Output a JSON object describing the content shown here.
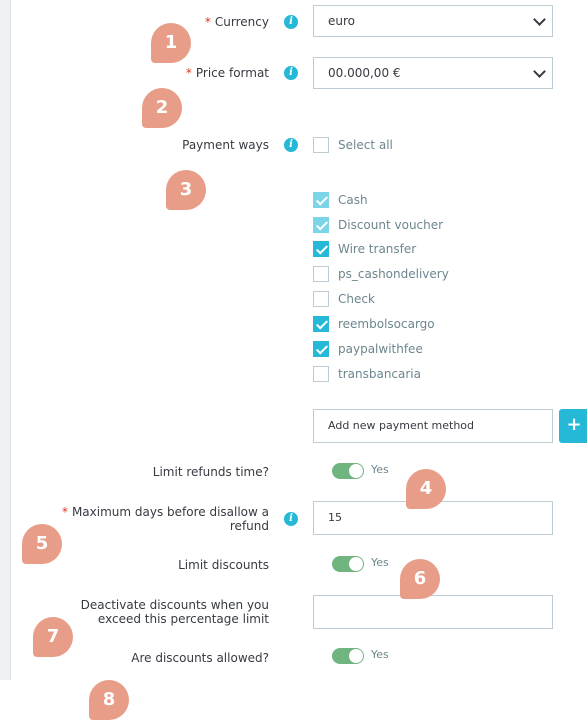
{
  "form": {
    "currency": {
      "label": "Currency",
      "value": "euro"
    },
    "price_format": {
      "label": "Price format",
      "value": "00.000,00 €"
    },
    "payment_ways": {
      "label": "Payment ways",
      "select_all": "Select all",
      "methods": [
        {
          "label": "Cash",
          "state": "checked-disabled"
        },
        {
          "label": "Discount voucher",
          "state": "checked-disabled"
        },
        {
          "label": "Wire transfer",
          "state": "checked"
        },
        {
          "label": "ps_cashondelivery",
          "state": "unchecked"
        },
        {
          "label": "Check",
          "state": "unchecked"
        },
        {
          "label": "reembolsocargo",
          "state": "checked"
        },
        {
          "label": "paypalwithfee",
          "state": "checked"
        },
        {
          "label": "transbancaria",
          "state": "unchecked"
        }
      ],
      "add_new_placeholder": "Add new payment method",
      "add_button": "+"
    },
    "limit_refunds": {
      "label": "Limit refunds time?",
      "toggle": "Yes"
    },
    "max_days": {
      "label_line1": "Maximum days before disallow a",
      "label_line2": "refund",
      "value": "15"
    },
    "limit_discounts": {
      "label": "Limit discounts",
      "toggle": "Yes"
    },
    "deactivate_discounts": {
      "label_line1": "Deactivate discounts when you",
      "label_line2": "exceed this percentage limit",
      "value": ""
    },
    "discounts_allowed": {
      "label": "Are discounts allowed?",
      "toggle": "Yes"
    }
  },
  "badges": [
    "1",
    "2",
    "3",
    "4",
    "5",
    "6",
    "7",
    "8"
  ],
  "colors": {
    "accent": "#25b9d7",
    "toggle_on": "#70b580",
    "badge": "#e79d87",
    "required": "#e0361b"
  }
}
